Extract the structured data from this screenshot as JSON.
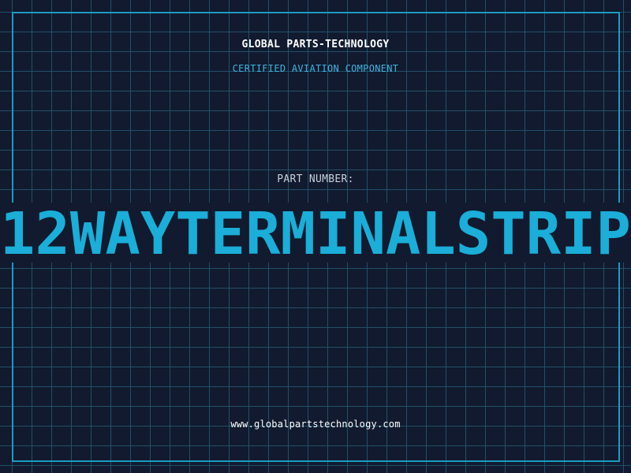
{
  "header": {
    "brand": "GLOBAL PARTS-TECHNOLOGY",
    "subtitle": "CERTIFIED AVIATION COMPONENT"
  },
  "main": {
    "label": "PART NUMBER:",
    "part_number": "12WAYTERMINALSTRIP"
  },
  "footer": {
    "url": "www.globalpartstechnology.com"
  },
  "colors": {
    "background": "#111a2e",
    "grid": "#23506a",
    "frame": "#1d9bc2",
    "accent": "#1aaed8",
    "subtitle": "#3fb4e0"
  }
}
